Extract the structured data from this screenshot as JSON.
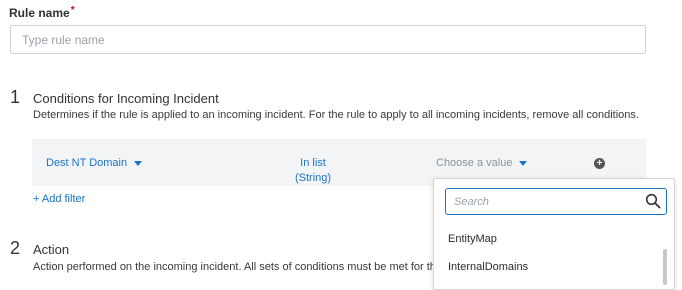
{
  "rule": {
    "label": "Rule name",
    "required_mark": "*",
    "placeholder": "Type rule name"
  },
  "section1": {
    "number": "1",
    "title": "Conditions for Incoming Incident",
    "description": "Determines if the rule is applied to an incoming incident. For the rule to apply to all incoming incidents, remove all conditions."
  },
  "condition": {
    "field": "Dest NT Domain",
    "operator_line1": "In list",
    "operator_line2": "(String)",
    "value_placeholder": "Choose a value",
    "add_icon": "plus-circle-icon"
  },
  "add_filter": "+ Add filter",
  "section2": {
    "number": "2",
    "title": "Action",
    "description": "Action performed on the incoming incident. All sets of conditions must be met for the actio"
  },
  "dropdown": {
    "search_placeholder": "Search",
    "search_icon": "search-icon",
    "options": [
      "EntityMap",
      "InternalDomains"
    ]
  },
  "colors": {
    "accent": "#1a73c9",
    "required": "#d0021b",
    "bar_bg": "#f3f4f5"
  }
}
